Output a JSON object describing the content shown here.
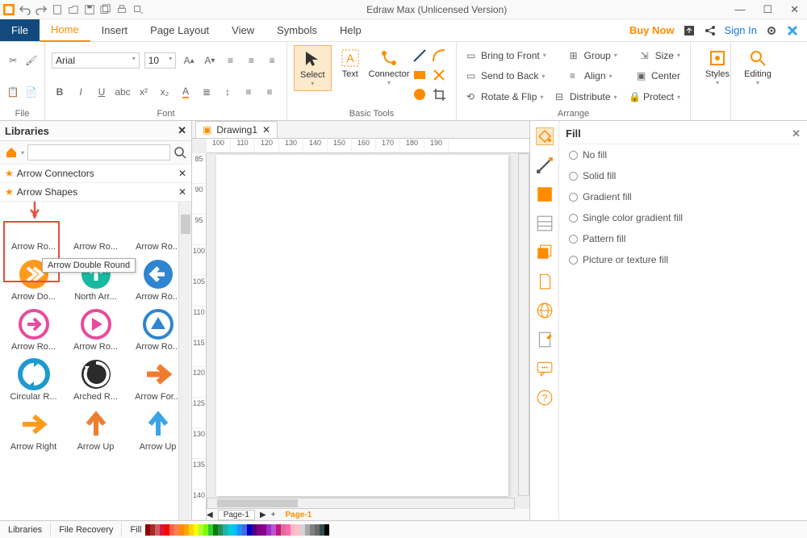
{
  "app": {
    "title": "Edraw Max (Unlicensed Version)"
  },
  "menu": {
    "file": "File",
    "tabs": [
      "Home",
      "Insert",
      "Page Layout",
      "View",
      "Symbols",
      "Help"
    ],
    "active_tab": "Home",
    "buy_now": "Buy Now",
    "sign_in": "Sign In"
  },
  "font": {
    "family": "Arial",
    "size": "10",
    "group_label": "File",
    "font_group_label": "Font"
  },
  "basic_tools": {
    "select": "Select",
    "text": "Text",
    "connector": "Connector",
    "group_label": "Basic Tools"
  },
  "arrange": {
    "bring_front": "Bring to Front",
    "send_back": "Send to Back",
    "rotate_flip": "Rotate & Flip",
    "group": "Group",
    "align": "Align",
    "distribute": "Distribute",
    "size": "Size",
    "center": "Center",
    "protect": "Protect",
    "group_label": "Arrange"
  },
  "right_ribbon": {
    "styles": "Styles",
    "editing": "Editing"
  },
  "libraries": {
    "title": "Libraries",
    "cat_connectors": "Arrow Connectors",
    "cat_shapes": "Arrow Shapes",
    "tooltip": "Arrow Double Round",
    "bottom_tabs": {
      "libraries": "Libraries",
      "file_recovery": "File Recovery"
    },
    "shapes": [
      {
        "label": "Arrow Ro..."
      },
      {
        "label": "Arrow Ro..."
      },
      {
        "label": "Arrow Ro..."
      },
      {
        "label": "Arrow Do..."
      },
      {
        "label": "North Arr..."
      },
      {
        "label": "Arrow Ro..."
      },
      {
        "label": "Arrow Ro..."
      },
      {
        "label": "Arrow Ro..."
      },
      {
        "label": "Arrow Ro..."
      },
      {
        "label": "Circular R..."
      },
      {
        "label": "Arched R..."
      },
      {
        "label": "Arrow For..."
      },
      {
        "label": "Arrow Right"
      },
      {
        "label": "Arrow Up"
      },
      {
        "label": "Arrow Up"
      }
    ]
  },
  "document": {
    "tab_name": "Drawing1",
    "page_name": "Page-1",
    "page_link": "Page-1"
  },
  "ruler_h": [
    "100",
    "110",
    "120",
    "130",
    "140",
    "150",
    "160",
    "170",
    "180",
    "190"
  ],
  "ruler_v": [
    "85",
    "90",
    "95",
    "100",
    "105",
    "110",
    "115",
    "120",
    "125",
    "130",
    "135",
    "140"
  ],
  "fill": {
    "title": "Fill",
    "options": [
      "No fill",
      "Solid fill",
      "Gradient fill",
      "Single color gradient fill",
      "Pattern fill",
      "Picture or texture fill"
    ]
  },
  "status": {
    "fill_label": "Fill"
  },
  "colors": {
    "orange": "#ff8c00",
    "teal": "#17b9a0",
    "blue": "#2f85cf",
    "pink": "#e84b9c",
    "navy": "#2b4a6f",
    "orange2": "#f07d2e",
    "skyblue": "#3aa4e8"
  }
}
